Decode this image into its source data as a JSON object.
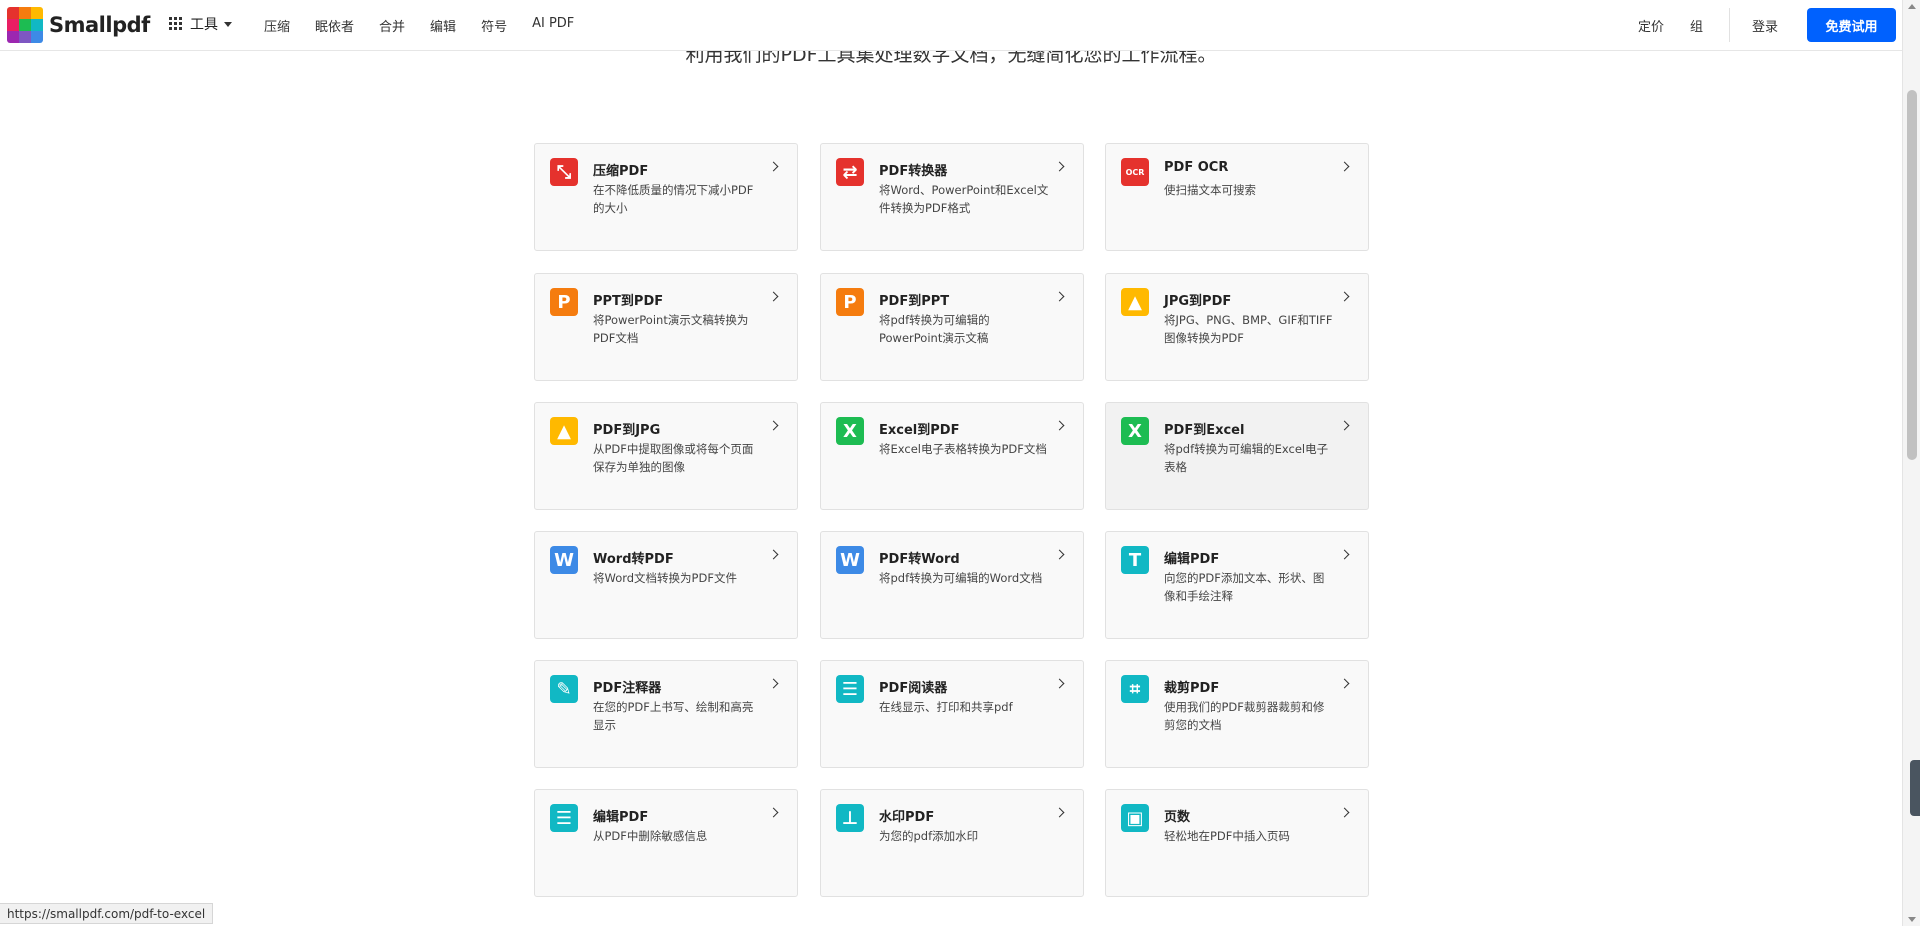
{
  "header": {
    "logo_text": "Smallpdf",
    "tools_label": "工具",
    "nav": [
      "压缩",
      "眠依者",
      "合并",
      "编辑",
      "符号",
      "AI PDF"
    ],
    "pricing": "定价",
    "team": "组",
    "login": "登录",
    "signup": "免费试用"
  },
  "subtitle": "利用我们的PDF工具集处理数字文档，无缝简化您的工作流程。",
  "tools": [
    {
      "title": "压缩PDF",
      "desc": "在不降低质量的情况下减小PDF的大小",
      "icon": "compress-icon",
      "color": "#e5322d",
      "glyph": "⤡"
    },
    {
      "title": "PDF转换器",
      "desc": "将Word、PowerPoint和Excel文件转换为PDF格式",
      "icon": "converter-icon",
      "color": "#e5322d",
      "glyph": "⇄"
    },
    {
      "title": "PDF OCR",
      "desc": "使扫描文本可搜索",
      "icon": "ocr-icon",
      "color": "#e5322d",
      "glyph": "OCR"
    },
    {
      "title": "PPT到PDF",
      "desc": "将PowerPoint演示文稿转换为PDF文档",
      "icon": "powerpoint-icon",
      "color": "#f57c0f",
      "glyph": "P"
    },
    {
      "title": "PDF到PPT",
      "desc": "将pdf转换为可编辑的PowerPoint演示文稿",
      "icon": "powerpoint-icon",
      "color": "#f57c0f",
      "glyph": "P"
    },
    {
      "title": "JPG到PDF",
      "desc": "将JPG、PNG、BMP、GIF和TIFF图像转换为PDF",
      "icon": "image-icon",
      "color": "#ffb900",
      "glyph": "▲"
    },
    {
      "title": "PDF到JPG",
      "desc": "从PDF中提取图像或将每个页面保存为单独的图像",
      "icon": "image-icon",
      "color": "#ffb900",
      "glyph": "▲"
    },
    {
      "title": "Excel到PDF",
      "desc": "将Excel电子表格转换为PDF文档",
      "icon": "excel-icon",
      "color": "#1dbc52",
      "glyph": "X"
    },
    {
      "title": "PDF到Excel",
      "desc": "将pdf转换为可编辑的Excel电子表格",
      "icon": "excel-icon",
      "color": "#1dbc52",
      "glyph": "X"
    },
    {
      "title": "Word转PDF",
      "desc": "将Word文档转换为PDF文件",
      "icon": "word-icon",
      "color": "#3d8ae6",
      "glyph": "W"
    },
    {
      "title": "PDF转Word",
      "desc": "将pdf转换为可编辑的Word文档",
      "icon": "word-icon",
      "color": "#3d8ae6",
      "glyph": "W"
    },
    {
      "title": "编辑PDF",
      "desc": "向您的PDF添加文本、形状、图像和手绘注释",
      "icon": "text-edit-icon",
      "color": "#11b8c4",
      "glyph": "T"
    },
    {
      "title": "PDF注释器",
      "desc": "在您的PDF上书写、绘制和高亮显示",
      "icon": "pen-icon",
      "color": "#11b8c4",
      "glyph": "✎"
    },
    {
      "title": "PDF阅读器",
      "desc": "在线显示、打印和共享pdf",
      "icon": "reader-icon",
      "color": "#11b8c4",
      "glyph": "☰"
    },
    {
      "title": "裁剪PDF",
      "desc": "使用我们的PDF裁剪器裁剪和修剪您的文档",
      "icon": "crop-icon",
      "color": "#11b8c4",
      "glyph": "⌗"
    },
    {
      "title": "编辑PDF",
      "desc": "从PDF中删除敏感信息",
      "icon": "redact-icon",
      "color": "#11b8c4",
      "glyph": "☰"
    },
    {
      "title": "水印PDF",
      "desc": "为您的pdf添加水印",
      "icon": "stamp-icon",
      "color": "#11b8c4",
      "glyph": "⊥"
    },
    {
      "title": "页数",
      "desc": "轻松地在PDF中插入页码",
      "icon": "page-number-icon",
      "color": "#11b8c4",
      "glyph": "▣"
    }
  ],
  "status_url": "https://smallpdf.com/pdf-to-excel"
}
